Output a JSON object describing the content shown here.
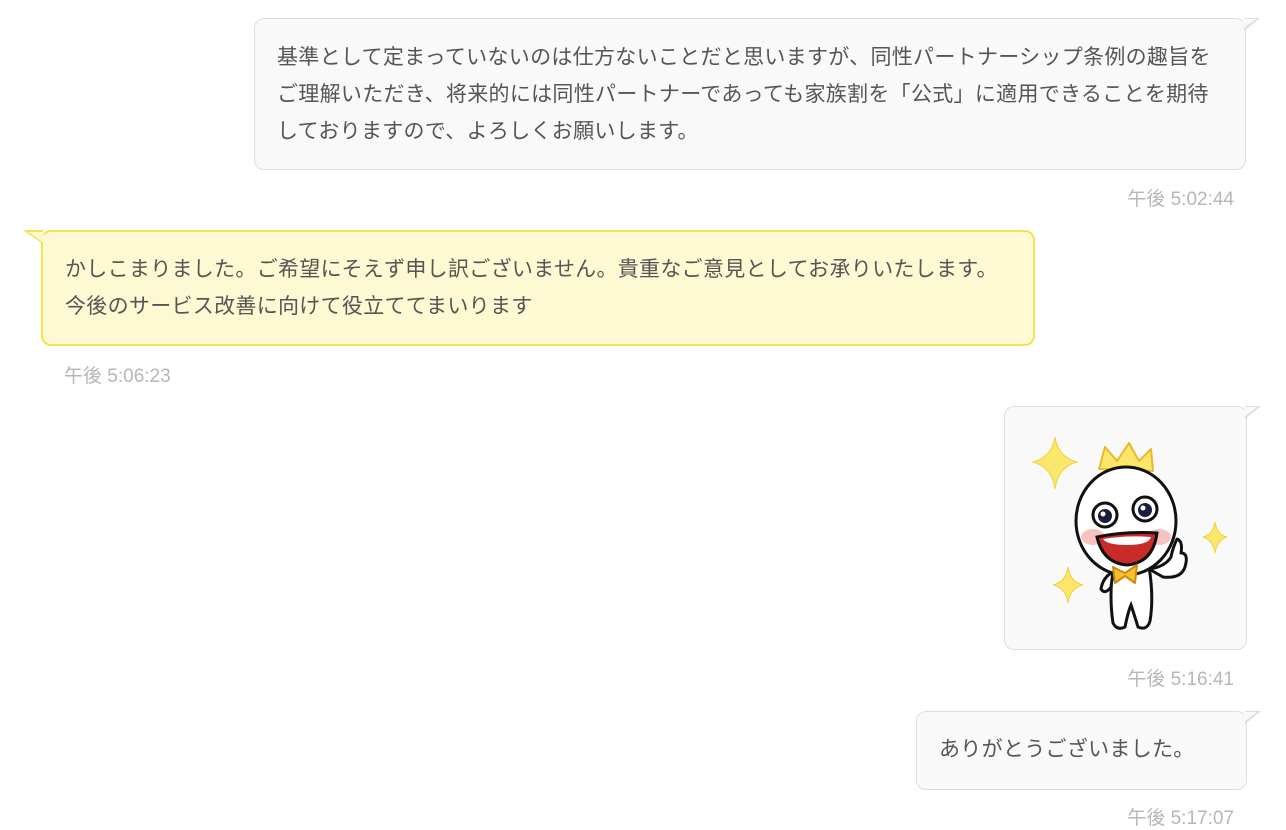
{
  "messages": [
    {
      "direction": "outgoing",
      "text": "基準として定まっていないのは仕方ないことだと思いますが、同性パートナーシップ条例の趣旨をご理解いただき、将来的には同性パートナーであっても家族割を「公式」に適用できることを期待しておりますので、よろしくお願いします。",
      "time": "午後 5:02:44"
    },
    {
      "direction": "incoming",
      "text": "かしこまりました。ご希望にそえず申し訳ございません。貴重なご意見としてお承りいたします。今後のサービス改善に向けて役立ててまいります",
      "time": "午後 5:06:23"
    },
    {
      "direction": "outgoing",
      "type": "sticker",
      "sticker": "thumbs-up-crown-character",
      "time": "午後 5:16:41"
    },
    {
      "direction": "outgoing",
      "text": "ありがとうございました。",
      "time": "午後 5:17:07"
    }
  ],
  "colors": {
    "outgoing_bg": "#f9f9f9",
    "outgoing_border": "#dedede",
    "incoming_bg": "#fdf9d2",
    "incoming_border": "#f5e24f",
    "text": "#555555",
    "timestamp": "#b6b6b6"
  }
}
